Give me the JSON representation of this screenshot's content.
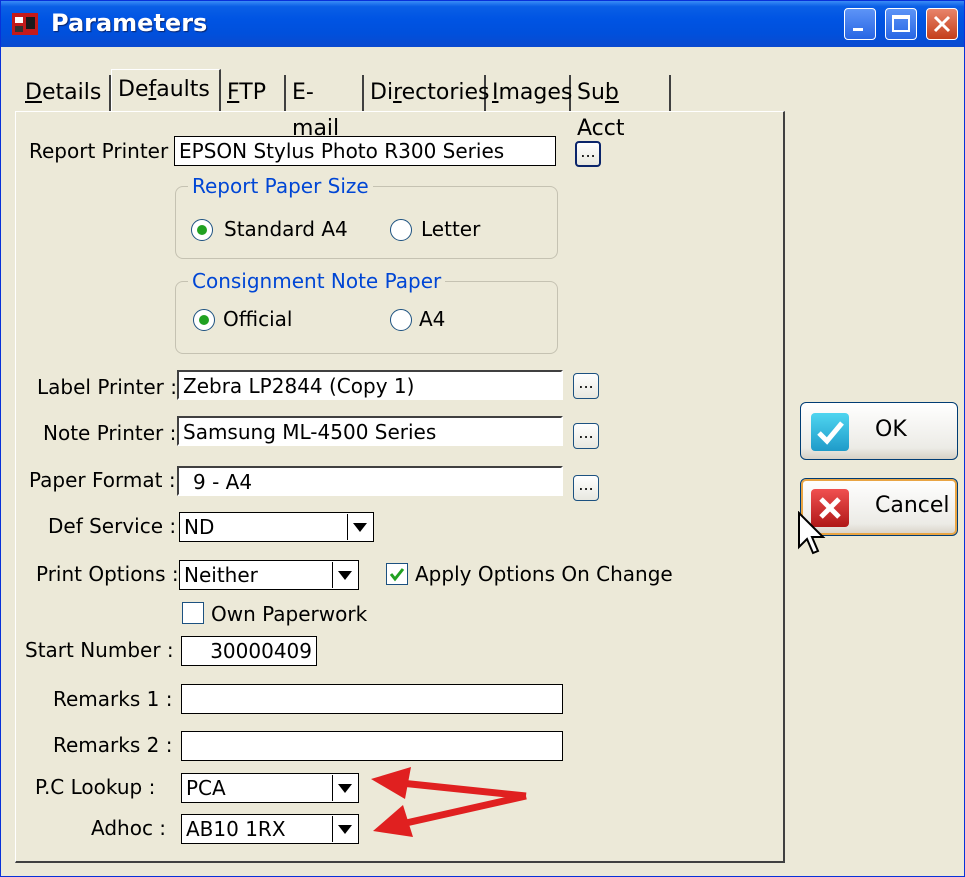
{
  "window": {
    "title": "Parameters"
  },
  "tabs": [
    {
      "pre": "",
      "u": "D",
      "post": "etails"
    },
    {
      "pre": "De",
      "u": "f",
      "post": "aults"
    },
    {
      "pre": "",
      "u": "F",
      "post": "TP"
    },
    {
      "pre": "E-",
      "u": "m",
      "post": "ail"
    },
    {
      "pre": "Di",
      "u": "r",
      "post": "ectories"
    },
    {
      "pre": "",
      "u": "I",
      "post": "mages"
    },
    {
      "pre": "Su",
      "u": "b",
      "post": " Acct"
    }
  ],
  "defaults": {
    "report_printer": {
      "label": "Report Printer :",
      "value": "EPSON Stylus Photo R300 Series"
    },
    "report_paper_size": {
      "title": "Report Paper Size",
      "opt1": "Standard A4",
      "opt2": "Letter"
    },
    "consignment_paper": {
      "title": "Consignment Note Paper",
      "opt1": "Official",
      "opt2": "A4"
    },
    "label_printer": {
      "label": "Label Printer :",
      "value": "Zebra LP2844 (Copy 1)"
    },
    "note_printer": {
      "label": "Note Printer :",
      "value": "Samsung ML-4500 Series"
    },
    "paper_format": {
      "label": "Paper Format :",
      "value": "9 - A4"
    },
    "def_service": {
      "label": "Def Service :",
      "value": "ND"
    },
    "print_options": {
      "label": "Print Options :",
      "value": "Neither"
    },
    "apply_options": {
      "label": "Apply Options On Change",
      "checked": true
    },
    "own_paperwork": {
      "label": "Own Paperwork",
      "checked": false
    },
    "start_number": {
      "label": "Start Number :",
      "value": "30000409"
    },
    "remarks1": {
      "label": "Remarks 1 :",
      "value": ""
    },
    "remarks2": {
      "label": "Remarks 2 :",
      "value": ""
    },
    "pc_lookup": {
      "label": "P.C Lookup :",
      "value": "PCA"
    },
    "adhoc": {
      "label": "Adhoc :",
      "value": "AB10 1RX"
    },
    "browse_label": "..."
  },
  "buttons": {
    "ok": "OK",
    "cancel": "Cancel"
  },
  "colors": {
    "title_blue": "#0054e3",
    "accent_red": "#e02020",
    "group_title": "#0046d5"
  }
}
